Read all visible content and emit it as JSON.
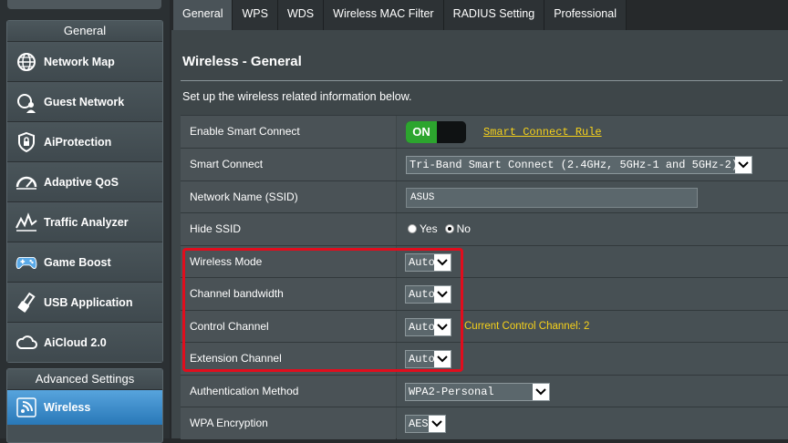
{
  "sidebar": {
    "general_header": "General",
    "items": [
      {
        "label": "Network Map",
        "icon": "globe-icon"
      },
      {
        "label": "Guest Network",
        "icon": "guest-network-icon"
      },
      {
        "label": "AiProtection",
        "icon": "lock-shield-icon"
      },
      {
        "label": "Adaptive QoS",
        "icon": "gauge-icon"
      },
      {
        "label": "Traffic Analyzer",
        "icon": "traffic-chart-icon"
      },
      {
        "label": "Game Boost",
        "icon": "gamepad-icon"
      },
      {
        "label": "USB Application",
        "icon": "usb-icon"
      },
      {
        "label": "AiCloud 2.0",
        "icon": "cloud-icon"
      }
    ],
    "advanced_header": "Advanced Settings",
    "advanced_items": [
      {
        "label": "Wireless",
        "icon": "wifi-icon",
        "active": true
      }
    ]
  },
  "tabs": [
    "General",
    "WPS",
    "WDS",
    "Wireless MAC Filter",
    "RADIUS Setting",
    "Professional"
  ],
  "active_tab": "General",
  "page": {
    "title": "Wireless - General",
    "subtitle": "Set up the wireless related information below."
  },
  "settings": {
    "smart_connect_enable": {
      "label": "Enable Smart Connect",
      "toggle": "ON",
      "link": "Smart Connect Rule"
    },
    "smart_connect": {
      "label": "Smart Connect",
      "value": "Tri-Band Smart Connect (2.4GHz, 5GHz-1 and 5GHz-2)"
    },
    "ssid": {
      "label": "Network Name (SSID)",
      "value": "ASUS"
    },
    "hide_ssid": {
      "label": "Hide SSID",
      "yes": "Yes",
      "no": "No",
      "selected": "No"
    },
    "wireless_mode": {
      "label": "Wireless Mode",
      "value": "Auto"
    },
    "channel_bandwidth": {
      "label": "Channel bandwidth",
      "value": "Auto"
    },
    "control_channel": {
      "label": "Control Channel",
      "value": "Auto",
      "note": "Current Control Channel: 2"
    },
    "extension_channel": {
      "label": "Extension Channel",
      "value": "Auto"
    },
    "auth_method": {
      "label": "Authentication Method",
      "value": "WPA2-Personal"
    },
    "wpa_encryption": {
      "label": "WPA Encryption",
      "value": "AES"
    }
  },
  "colors": {
    "accent_yellow": "#f7d21a",
    "toggle_green": "#2ca52e",
    "highlight_red": "#e10d1d",
    "active_blue": "#2978b8"
  }
}
